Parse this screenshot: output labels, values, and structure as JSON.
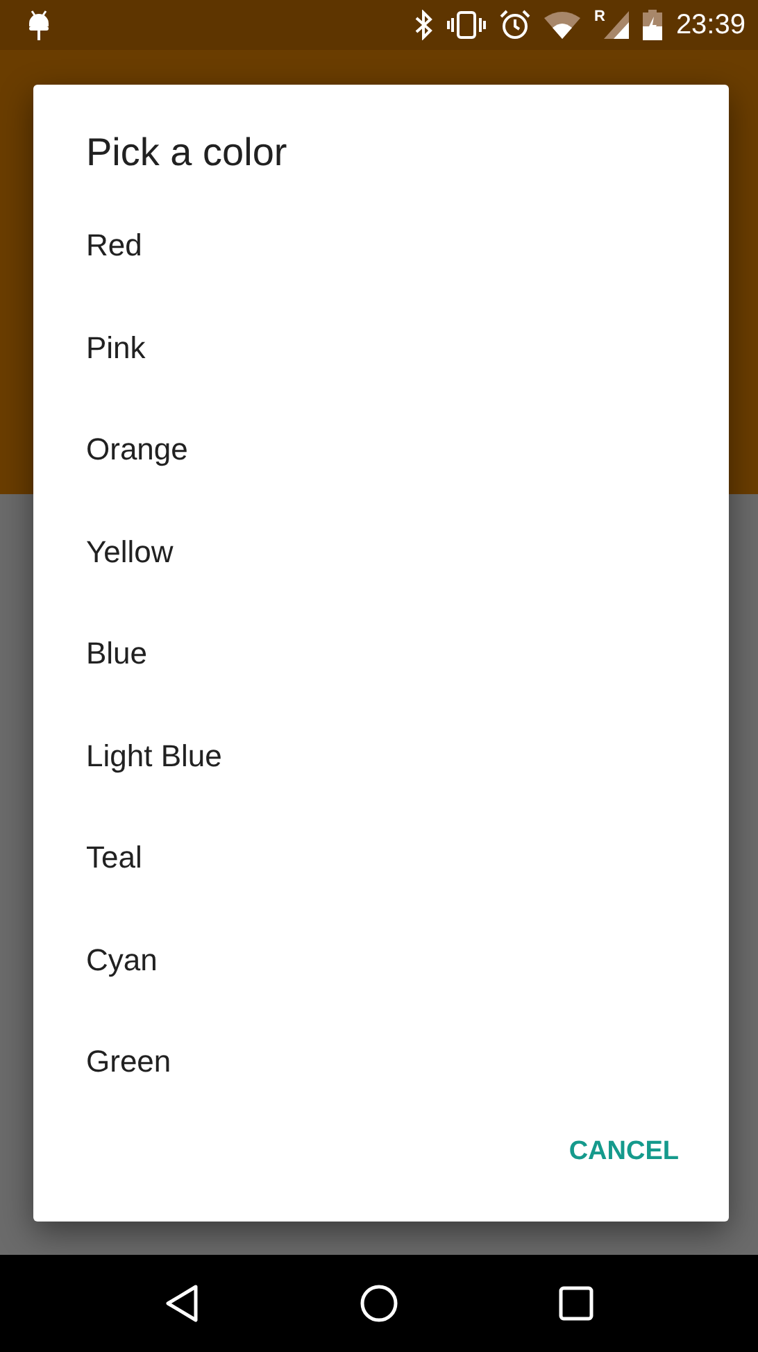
{
  "status_bar": {
    "roaming_mark": "R",
    "time": "23:39"
  },
  "dialog": {
    "title": "Pick a color",
    "items": [
      {
        "label": "Red"
      },
      {
        "label": "Pink"
      },
      {
        "label": "Orange"
      },
      {
        "label": "Yellow"
      },
      {
        "label": "Blue"
      },
      {
        "label": "Light Blue"
      },
      {
        "label": "Teal"
      },
      {
        "label": "Cyan"
      },
      {
        "label": "Green"
      }
    ],
    "buttons": [
      "CANCEL"
    ]
  }
}
